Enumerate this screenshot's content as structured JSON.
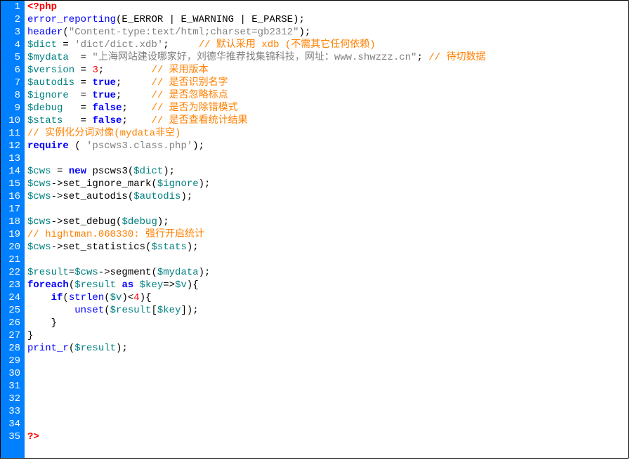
{
  "lines": [
    {
      "n": "1",
      "segs": [
        {
          "t": "<?php",
          "c": "t-tag"
        }
      ]
    },
    {
      "n": "2",
      "segs": [
        {
          "t": "error_reporting",
          "c": "t-fn"
        },
        {
          "t": "(E_ERROR | E_WARNING | E_PARSE);"
        }
      ]
    },
    {
      "n": "3",
      "segs": [
        {
          "t": "header",
          "c": "t-fn"
        },
        {
          "t": "("
        },
        {
          "t": "\"Content-type:text/html;charset=gb2312\"",
          "c": "t-str"
        },
        {
          "t": ");"
        }
      ]
    },
    {
      "n": "4",
      "segs": [
        {
          "t": "$dict",
          "c": "t-var"
        },
        {
          "t": " = "
        },
        {
          "t": "'dict/dict.xdb'",
          "c": "t-str"
        },
        {
          "t": ";     "
        },
        {
          "t": "// 默认采用 xdb (不需其它任何依赖)",
          "c": "t-cm"
        }
      ]
    },
    {
      "n": "5",
      "segs": [
        {
          "t": "$mydata",
          "c": "t-var"
        },
        {
          "t": "  = "
        },
        {
          "t": "\"上海网站建设哪家好，刘德华推荐找集锦科技，网址：www.shwzzz.cn\"",
          "c": "t-str"
        },
        {
          "t": "; "
        },
        {
          "t": "// 待切数据",
          "c": "t-cm"
        }
      ]
    },
    {
      "n": "6",
      "segs": [
        {
          "t": "$version",
          "c": "t-var"
        },
        {
          "t": " = "
        },
        {
          "t": "3",
          "c": "t-num"
        },
        {
          "t": ";        "
        },
        {
          "t": "// 采用版本",
          "c": "t-cm"
        }
      ]
    },
    {
      "n": "7",
      "segs": [
        {
          "t": "$autodis",
          "c": "t-var"
        },
        {
          "t": " = "
        },
        {
          "t": "true",
          "c": "t-bool"
        },
        {
          "t": ";     "
        },
        {
          "t": "// 是否识别名字",
          "c": "t-cm"
        }
      ]
    },
    {
      "n": "8",
      "segs": [
        {
          "t": "$ignore",
          "c": "t-var"
        },
        {
          "t": "  = "
        },
        {
          "t": "true",
          "c": "t-bool"
        },
        {
          "t": ";     "
        },
        {
          "t": "// 是否忽略标点",
          "c": "t-cm"
        }
      ]
    },
    {
      "n": "9",
      "segs": [
        {
          "t": "$debug",
          "c": "t-var"
        },
        {
          "t": "   = "
        },
        {
          "t": "false",
          "c": "t-bool"
        },
        {
          "t": ";    "
        },
        {
          "t": "// 是否为除错模式",
          "c": "t-cm"
        }
      ]
    },
    {
      "n": "10",
      "segs": [
        {
          "t": "$stats",
          "c": "t-var"
        },
        {
          "t": "   = "
        },
        {
          "t": "false",
          "c": "t-bool"
        },
        {
          "t": ";    "
        },
        {
          "t": "// 是否查看统计结果",
          "c": "t-cm"
        }
      ]
    },
    {
      "n": "11",
      "segs": [
        {
          "t": "// 实例化分词对像(mydata非空)",
          "c": "t-cm"
        }
      ]
    },
    {
      "n": "12",
      "segs": [
        {
          "t": "require",
          "c": "t-kw"
        },
        {
          "t": " ( "
        },
        {
          "t": "'pscws3.class.php'",
          "c": "t-str"
        },
        {
          "t": ");"
        }
      ]
    },
    {
      "n": "13",
      "segs": []
    },
    {
      "n": "14",
      "segs": [
        {
          "t": "$cws",
          "c": "t-var"
        },
        {
          "t": " = "
        },
        {
          "t": "new",
          "c": "t-kw"
        },
        {
          "t": " pscws3("
        },
        {
          "t": "$dict",
          "c": "t-var"
        },
        {
          "t": ");"
        }
      ]
    },
    {
      "n": "15",
      "segs": [
        {
          "t": "$cws",
          "c": "t-var"
        },
        {
          "t": "->set_ignore_mark("
        },
        {
          "t": "$ignore",
          "c": "t-var"
        },
        {
          "t": ");"
        }
      ]
    },
    {
      "n": "16",
      "segs": [
        {
          "t": "$cws",
          "c": "t-var"
        },
        {
          "t": "->set_autodis("
        },
        {
          "t": "$autodis",
          "c": "t-var"
        },
        {
          "t": ");"
        }
      ]
    },
    {
      "n": "17",
      "segs": []
    },
    {
      "n": "18",
      "segs": [
        {
          "t": "$cws",
          "c": "t-var"
        },
        {
          "t": "->set_debug("
        },
        {
          "t": "$debug",
          "c": "t-var"
        },
        {
          "t": ");"
        }
      ]
    },
    {
      "n": "19",
      "segs": [
        {
          "t": "// hightman.060330: 强行开启统计",
          "c": "t-cm"
        }
      ]
    },
    {
      "n": "20",
      "segs": [
        {
          "t": "$cws",
          "c": "t-var"
        },
        {
          "t": "->set_statistics("
        },
        {
          "t": "$stats",
          "c": "t-var"
        },
        {
          "t": ");"
        }
      ]
    },
    {
      "n": "21",
      "segs": []
    },
    {
      "n": "22",
      "segs": [
        {
          "t": "$result",
          "c": "t-var"
        },
        {
          "t": "="
        },
        {
          "t": "$cws",
          "c": "t-var"
        },
        {
          "t": "->segment("
        },
        {
          "t": "$mydata",
          "c": "t-var"
        },
        {
          "t": ");"
        }
      ]
    },
    {
      "n": "23",
      "segs": [
        {
          "t": "foreach",
          "c": "t-kw"
        },
        {
          "t": "("
        },
        {
          "t": "$result",
          "c": "t-var"
        },
        {
          "t": " "
        },
        {
          "t": "as",
          "c": "t-kw"
        },
        {
          "t": " "
        },
        {
          "t": "$key",
          "c": "t-var"
        },
        {
          "t": "=>"
        },
        {
          "t": "$v",
          "c": "t-var"
        },
        {
          "t": "){"
        }
      ]
    },
    {
      "n": "24",
      "segs": [
        {
          "t": "    "
        },
        {
          "t": "if",
          "c": "t-kw"
        },
        {
          "t": "("
        },
        {
          "t": "strlen",
          "c": "t-fn"
        },
        {
          "t": "("
        },
        {
          "t": "$v",
          "c": "t-var"
        },
        {
          "t": ")<"
        },
        {
          "t": "4",
          "c": "t-num"
        },
        {
          "t": "){"
        }
      ]
    },
    {
      "n": "25",
      "segs": [
        {
          "t": "        "
        },
        {
          "t": "unset",
          "c": "t-fn"
        },
        {
          "t": "("
        },
        {
          "t": "$result",
          "c": "t-var"
        },
        {
          "t": "["
        },
        {
          "t": "$key",
          "c": "t-var"
        },
        {
          "t": "]);"
        }
      ]
    },
    {
      "n": "26",
      "segs": [
        {
          "t": "    }"
        }
      ]
    },
    {
      "n": "27",
      "segs": [
        {
          "t": "}"
        }
      ]
    },
    {
      "n": "28",
      "segs": [
        {
          "t": "print_r",
          "c": "t-fn"
        },
        {
          "t": "("
        },
        {
          "t": "$result",
          "c": "t-var"
        },
        {
          "t": ");"
        }
      ]
    },
    {
      "n": "29",
      "segs": []
    },
    {
      "n": "30",
      "segs": []
    },
    {
      "n": "31",
      "segs": []
    },
    {
      "n": "32",
      "segs": []
    },
    {
      "n": "33",
      "segs": []
    },
    {
      "n": "34",
      "segs": []
    },
    {
      "n": "35",
      "segs": [
        {
          "t": "?>",
          "c": "t-tag"
        }
      ]
    }
  ]
}
